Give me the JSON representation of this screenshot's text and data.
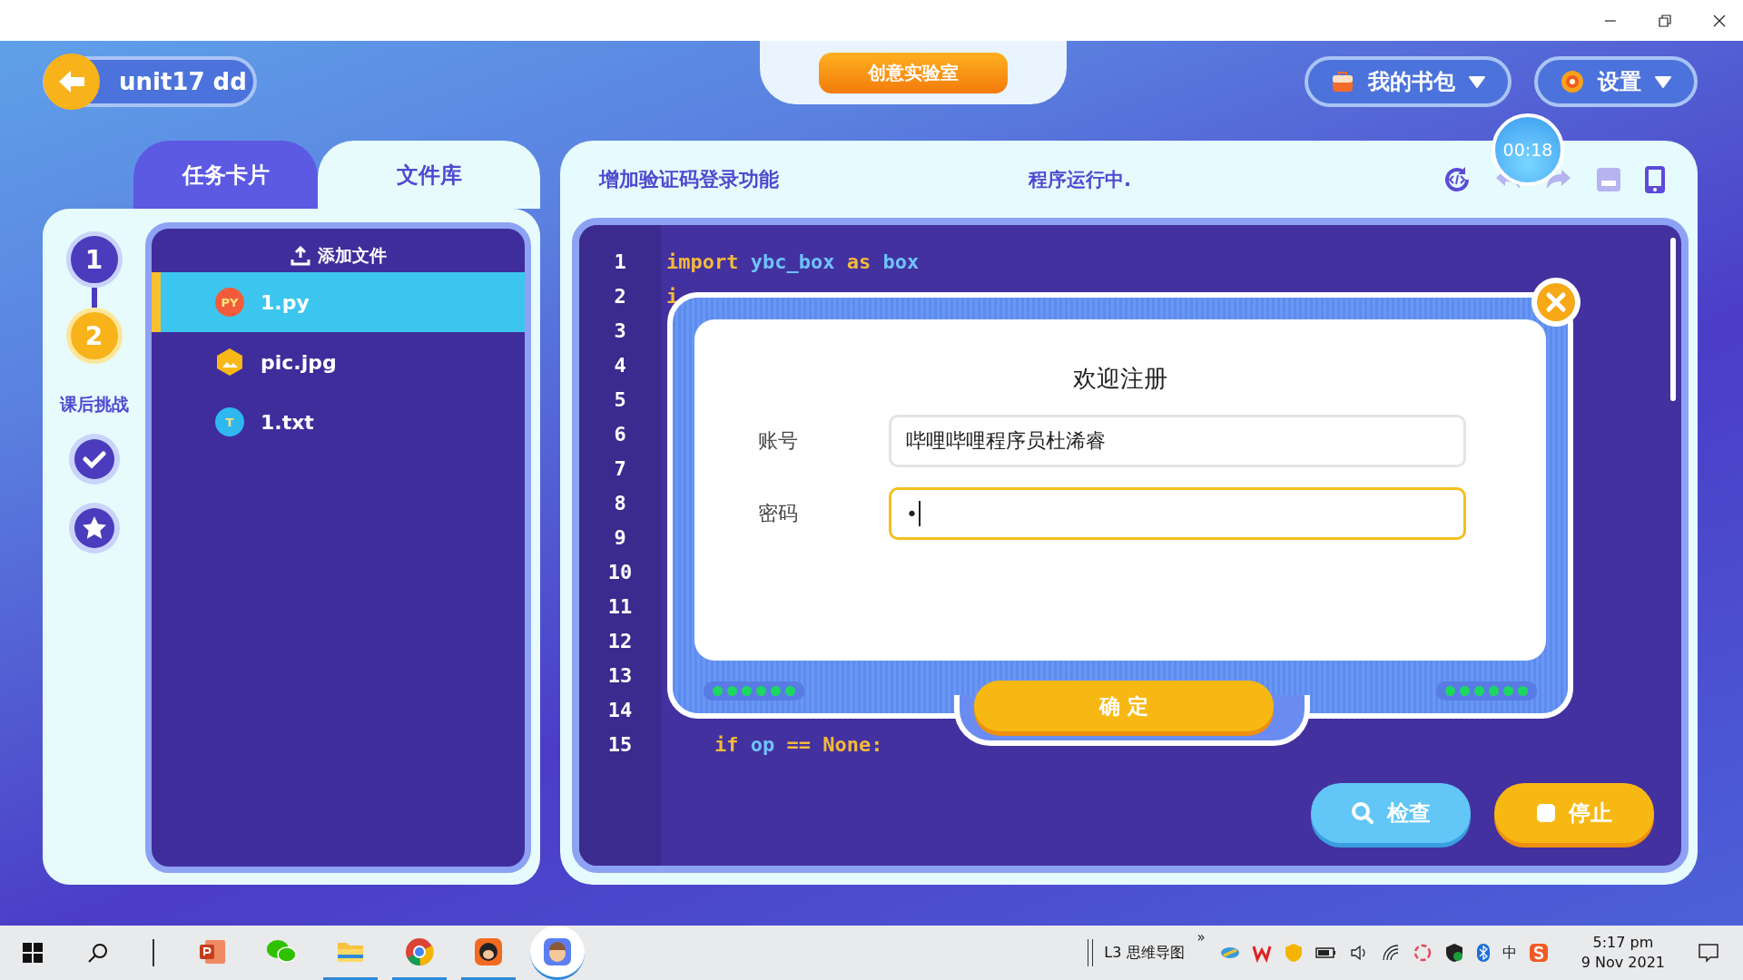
{
  "header": {
    "back_label": "unit17 dd",
    "center_tab": "创意实验室",
    "menus": [
      {
        "label": "我的书包",
        "kind": "bag"
      },
      {
        "label": "设置",
        "kind": "settings"
      }
    ]
  },
  "left_panel": {
    "tabs": [
      {
        "label": "任务卡片",
        "selected": false
      },
      {
        "label": "文件库",
        "selected": true
      }
    ],
    "steps": [
      {
        "label": "1",
        "selected": false
      },
      {
        "label": "2",
        "selected": true
      }
    ],
    "challenge_label": "课后挑战",
    "challenges": [
      {
        "kind": "check"
      },
      {
        "kind": "star"
      }
    ],
    "add_file_label": "添加文件",
    "files": [
      {
        "name": "1.py",
        "kind": "py",
        "badge": "PY",
        "selected": true
      },
      {
        "name": "pic.jpg",
        "kind": "image",
        "selected": false
      },
      {
        "name": "1.txt",
        "kind": "text",
        "badge": "T",
        "selected": false
      }
    ]
  },
  "editor": {
    "title": "增加验证码登录功能",
    "status": "程序运行中.",
    "timer": "00:18",
    "lines": [
      {
        "number": "1",
        "tokens": [
          {
            "text": "import ",
            "kind": "keyword"
          },
          {
            "text": "ybc_box ",
            "kind": "name"
          },
          {
            "text": "as ",
            "kind": "keyword"
          },
          {
            "text": "box",
            "kind": "name"
          }
        ]
      },
      {
        "number": "2",
        "tokens": [
          {
            "text": "i",
            "kind": "keyword"
          }
        ]
      },
      {
        "number": "3"
      },
      {
        "number": "4"
      },
      {
        "number": "5"
      },
      {
        "number": "6"
      },
      {
        "number": "7"
      },
      {
        "number": "8"
      },
      {
        "number": "9"
      },
      {
        "number": "10"
      },
      {
        "number": "11"
      },
      {
        "number": "12"
      },
      {
        "number": "13"
      },
      {
        "number": "14"
      },
      {
        "number": "15",
        "tokens": [
          {
            "text": "    if ",
            "kind": "keyword"
          },
          {
            "text": "op ",
            "kind": "name"
          },
          {
            "text": "== None:",
            "kind": "keyword"
          }
        ]
      }
    ],
    "actions": [
      {
        "label": "检查",
        "kind": "check"
      },
      {
        "label": "停止",
        "kind": "stop"
      }
    ]
  },
  "dialog": {
    "title": "欢迎注册",
    "fields": [
      {
        "label": "账号",
        "value": "哔哩哔哩程序员杜浠睿",
        "focused": false
      },
      {
        "label": "密码",
        "value": "•",
        "focused": true
      }
    ],
    "confirm": "确 定"
  },
  "taskbar": {
    "apps": [
      {
        "kind": "powerpoint",
        "running": false,
        "active": false
      },
      {
        "kind": "chat",
        "running": false,
        "active": false
      },
      {
        "kind": "folder",
        "running": true,
        "active": false
      },
      {
        "kind": "browser",
        "running": true,
        "active": false
      },
      {
        "kind": "monkey",
        "running": true,
        "active": false
      },
      {
        "kind": "mascot",
        "running": true,
        "active": true
      }
    ],
    "toolbar_label": "L3 思维导图",
    "chevron": "»",
    "ime": "中",
    "time": "5:17 pm",
    "date": "9 Nov 2021"
  }
}
